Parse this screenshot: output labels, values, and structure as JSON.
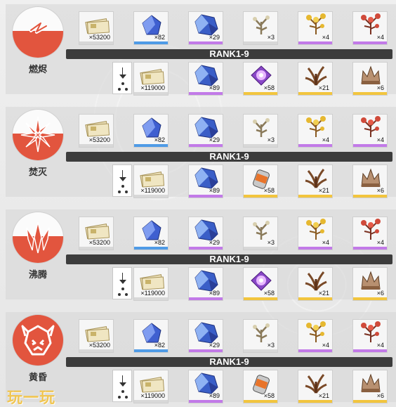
{
  "colors": {
    "accent": "#e2553e",
    "rank_bar": "#3c3c3c",
    "quality_white": "#d8d8d8",
    "quality_blue": "#4f9be6",
    "quality_purple": "#c27ae8",
    "quality_gold": "#f2c53e"
  },
  "elements": [
    {
      "name": "燃烬",
      "emblem_icon": "lightning-bolt-icon",
      "rank_label": "RANK1-9",
      "row1": [
        {
          "icon": "credit-bills-icon",
          "qty": "×53200",
          "quality": "white"
        },
        {
          "icon": "blue-crystal-small-icon",
          "qty": "×82",
          "quality": "blue"
        },
        {
          "icon": "blue-crystal-large-icon",
          "qty": "×29",
          "quality": "purple"
        },
        {
          "icon": "plant-sprout-icon",
          "qty": "×3",
          "quality": "white"
        },
        {
          "icon": "gold-plant-icon",
          "qty": "×4",
          "quality": "purple"
        },
        {
          "icon": "red-plant-icon",
          "qty": "×4",
          "quality": "purple"
        }
      ],
      "row2": [
        {
          "icon": "credit-bills-icon",
          "qty": "×119000",
          "quality": "white"
        },
        {
          "icon": "blue-crystal-large-icon",
          "qty": "×89",
          "quality": "purple"
        },
        {
          "icon": "purple-orb-icon",
          "qty": "×58",
          "quality": "gold"
        },
        {
          "icon": "brown-plant-icon",
          "qty": "×21",
          "quality": "gold"
        },
        {
          "icon": "crown-plant-icon",
          "qty": "×6",
          "quality": "gold"
        }
      ]
    },
    {
      "name": "焚灭",
      "emblem_icon": "starburst-icon",
      "rank_label": "RANK1-9",
      "row1": [
        {
          "icon": "credit-bills-icon",
          "qty": "×53200",
          "quality": "white"
        },
        {
          "icon": "blue-crystal-small-icon",
          "qty": "×82",
          "quality": "blue"
        },
        {
          "icon": "blue-crystal-large-icon",
          "qty": "×29",
          "quality": "purple"
        },
        {
          "icon": "plant-sprout-icon",
          "qty": "×3",
          "quality": "white"
        },
        {
          "icon": "gold-plant-icon",
          "qty": "×4",
          "quality": "purple"
        },
        {
          "icon": "red-plant-icon",
          "qty": "×4",
          "quality": "purple"
        }
      ],
      "row2": [
        {
          "icon": "credit-bills-icon",
          "qty": "×119000",
          "quality": "white"
        },
        {
          "icon": "blue-crystal-large-icon",
          "qty": "×89",
          "quality": "purple"
        },
        {
          "icon": "orange-canister-icon",
          "qty": "×58",
          "quality": "gold"
        },
        {
          "icon": "brown-plant-icon",
          "qty": "×21",
          "quality": "gold"
        },
        {
          "icon": "crown-plant-icon",
          "qty": "×6",
          "quality": "gold"
        }
      ]
    },
    {
      "name": "沸腾",
      "emblem_icon": "spikes-icon",
      "rank_label": "RANK1-9",
      "row1": [
        {
          "icon": "credit-bills-icon",
          "qty": "×53200",
          "quality": "white"
        },
        {
          "icon": "blue-crystal-small-icon",
          "qty": "×82",
          "quality": "blue"
        },
        {
          "icon": "blue-crystal-large-icon",
          "qty": "×29",
          "quality": "purple"
        },
        {
          "icon": "plant-sprout-icon",
          "qty": "×3",
          "quality": "white"
        },
        {
          "icon": "gold-plant-icon",
          "qty": "×4",
          "quality": "purple"
        },
        {
          "icon": "red-plant-icon",
          "qty": "×4",
          "quality": "purple"
        }
      ],
      "row2": [
        {
          "icon": "credit-bills-icon",
          "qty": "×119000",
          "quality": "white"
        },
        {
          "icon": "blue-crystal-large-icon",
          "qty": "×89",
          "quality": "purple"
        },
        {
          "icon": "purple-orb-icon",
          "qty": "×58",
          "quality": "gold"
        },
        {
          "icon": "brown-plant-icon",
          "qty": "×21",
          "quality": "gold"
        },
        {
          "icon": "crown-plant-icon",
          "qty": "×6",
          "quality": "gold"
        }
      ]
    },
    {
      "name": "黄昏",
      "emblem_icon": "demon-mask-icon",
      "rank_label": "RANK1-9",
      "row1": [
        {
          "icon": "credit-bills-icon",
          "qty": "×53200",
          "quality": "white"
        },
        {
          "icon": "blue-crystal-small-icon",
          "qty": "×82",
          "quality": "blue"
        },
        {
          "icon": "blue-crystal-large-icon",
          "qty": "×29",
          "quality": "purple"
        },
        {
          "icon": "plant-sprout-icon",
          "qty": "×3",
          "quality": "white"
        },
        {
          "icon": "gold-plant-icon",
          "qty": "×4",
          "quality": "purple"
        },
        {
          "icon": "red-plant-icon",
          "qty": "×4",
          "quality": "purple"
        }
      ],
      "row2": [
        {
          "icon": "credit-bills-icon",
          "qty": "×119000",
          "quality": "white"
        },
        {
          "icon": "blue-crystal-large-icon",
          "qty": "×89",
          "quality": "purple"
        },
        {
          "icon": "orange-canister-icon",
          "qty": "×58",
          "quality": "gold"
        },
        {
          "icon": "brown-plant-icon",
          "qty": "×21",
          "quality": "gold"
        },
        {
          "icon": "crown-plant-icon",
          "qty": "×6",
          "quality": "gold"
        }
      ]
    }
  ],
  "watermark": "玩一玩"
}
